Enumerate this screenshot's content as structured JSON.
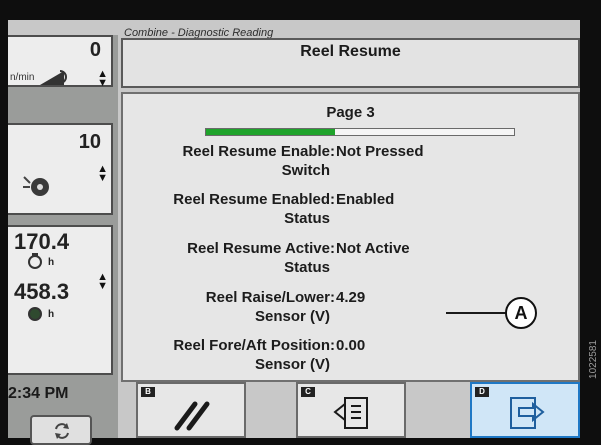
{
  "app_title": "Combine - Diagnostic Reading",
  "header": {
    "title": "Reel Resume"
  },
  "page": {
    "label": "Page 3",
    "progress_fraction": 0.42
  },
  "rows": [
    {
      "label_line1": "Reel Resume Enable",
      "label_line2": "Switch",
      "value": "Not Pressed"
    },
    {
      "label_line1": "Reel Resume Enabled",
      "label_line2": "Status",
      "value": "Enabled"
    },
    {
      "label_line1": "Reel Resume Active",
      "label_line2": "Status",
      "value": "Not Active"
    },
    {
      "label_line1": "Reel Raise/Lower",
      "label_line2": "Sensor (V)",
      "value": "4.29"
    },
    {
      "label_line1": "Reel Fore/Aft Position",
      "label_line2": "Sensor (V)",
      "value": "0.00"
    }
  ],
  "callout_label": "A",
  "sidebar": {
    "speed": {
      "value": "0",
      "unit": "n/min"
    },
    "rotor": {
      "value": "10"
    },
    "hours": {
      "engine": "170.4",
      "separator": "458.3",
      "unit": "h"
    },
    "time": "2:34 PM"
  },
  "softkeys": [
    {
      "tag": "B",
      "icon": "slash-slash-icon"
    },
    {
      "tag": "C",
      "icon": "page-left-icon"
    },
    {
      "tag": "D",
      "icon": "page-right-icon"
    }
  ],
  "figure_id": "1022581",
  "colors": {
    "progress": "#1fa32b",
    "active_key": "#1f78c5",
    "bezel": "#0e0e0e"
  }
}
